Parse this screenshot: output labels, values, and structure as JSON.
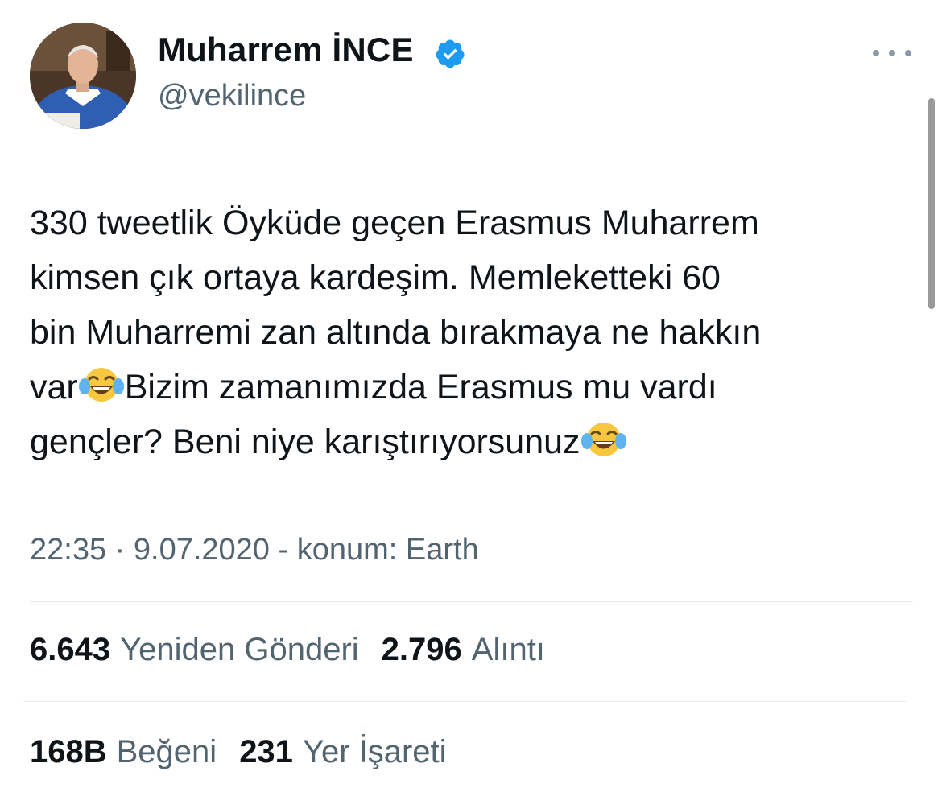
{
  "author": {
    "name": "Muharrem İNCE",
    "handle": "@vekilince",
    "verified": true,
    "avatar_icon": "profile-photo"
  },
  "tweet": {
    "text_parts": [
      "330 tweetlik Öyküde geçen Erasmus Muharrem\nkimsen çık ortaya kardeşim. Memleketteki 60\nbin Muharremi zan altında bırakmaya ne hakkın\nvar",
      "Bizim zamanımızda Erasmus mu vardı\ngençler? Beni niye karıştırıyorsunuz"
    ],
    "emoji": "face-with-tears-of-joy"
  },
  "meta": {
    "time": "22:35",
    "date": "9.07.2020",
    "location": "konum: Earth"
  },
  "stats": {
    "retweets": {
      "value": "6.643",
      "label": "Yeniden Gönderi"
    },
    "quotes": {
      "value": "2.796",
      "label": "Alıntı"
    },
    "likes": {
      "value": "168B",
      "label": "Beğeni"
    },
    "bookmarks": {
      "value": "231",
      "label": "Yer İşareti"
    }
  },
  "colors": {
    "text": "#0f1419",
    "secondary": "#536471",
    "verified": "#1d9bf0",
    "divider": "#e6ecf0"
  }
}
